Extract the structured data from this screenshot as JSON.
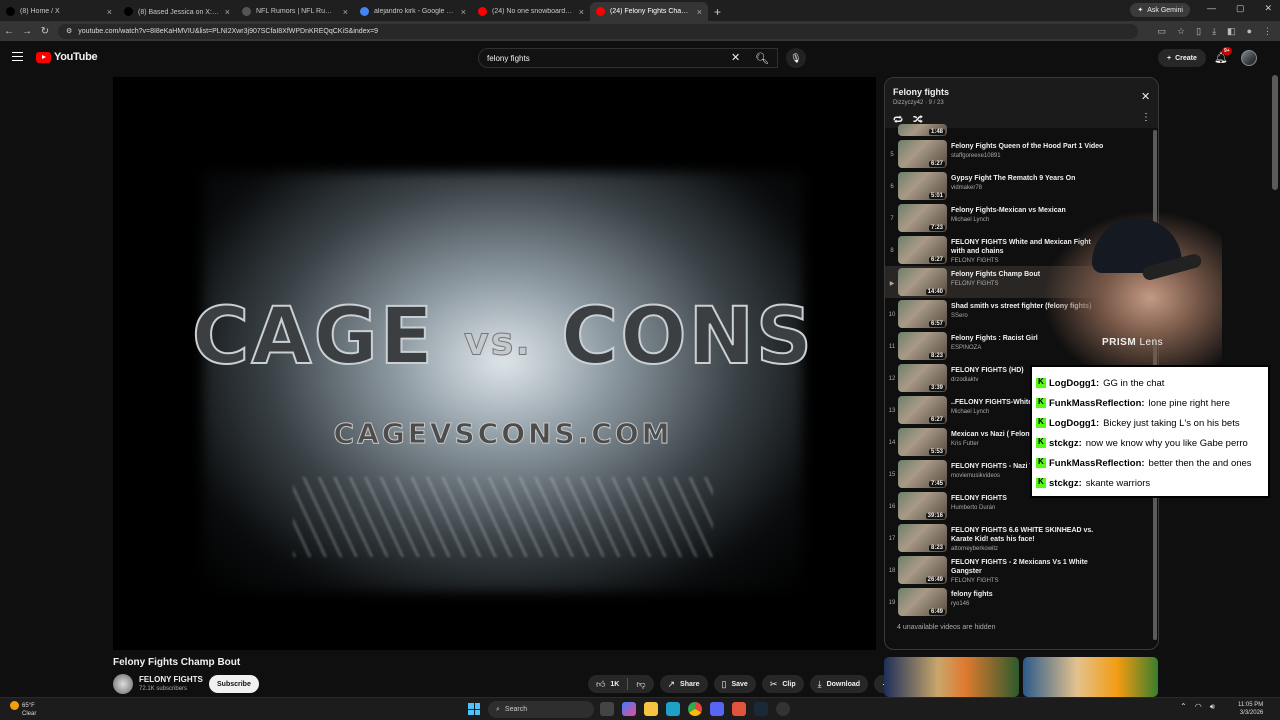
{
  "browser": {
    "tabs": [
      {
        "label": "(8) Home / X",
        "icon": "x-logo-icon",
        "color": "#000000"
      },
      {
        "label": "(8) Based Jessica on X: \"🚨 Arti",
        "icon": "x-logo-icon",
        "color": "#000000"
      },
      {
        "label": "NFL Rumors | NFL Rumors New",
        "icon": "page-icon",
        "color": "#555555"
      },
      {
        "label": "alejandro kirk - Google Search",
        "icon": "google-icon",
        "color": "#4285f4"
      },
      {
        "label": "(24) No one snowboards like Ze",
        "icon": "youtube-icon",
        "color": "#ff0000"
      },
      {
        "label": "(24) Felony Fights Champ Bout",
        "icon": "youtube-icon",
        "color": "#ff0000",
        "active": true
      }
    ],
    "new_tab": "+",
    "ask_gemini": "Ask Gemini",
    "url": "youtube.com/watch?v=8I8eKaHMVIU&list=PLNI2Xwr3j907SCfaI8XfWPDnKREQqCKiS&index=9"
  },
  "header": {
    "logo": "YouTube",
    "search_value": "felony fights",
    "create_label": "Create",
    "notification_count": "9+"
  },
  "video": {
    "title_art": "CAGE",
    "vs_art": "vs.",
    "cons_art": "CONS",
    "url_art": "CAGEVSCONS.COM",
    "title": "Felony Fights Champ Bout",
    "channel": "FELONY FIGHTS",
    "subscribers": "72.1K subscribers",
    "subscribe_label": "Subscribe",
    "likes": "1K",
    "share_label": "Share",
    "save_label": "Save",
    "clip_label": "Clip",
    "download_label": "Download"
  },
  "playlist": {
    "title": "Felony fights",
    "subtitle": "Dizzyczy42 · 9 / 23",
    "hidden_note": "4 unavailable videos are hidden",
    "items": [
      {
        "idx": "",
        "title": "",
        "channel": "",
        "duration": "1:48",
        "partial": true
      },
      {
        "idx": "5",
        "title": "Felony Fights Queen of the Hood Part 1 Video",
        "channel": "staffgoreexe10891",
        "duration": "6:27"
      },
      {
        "idx": "6",
        "title": "Gypsy Fight The Rematch 9 Years On",
        "channel": "vidmaker78",
        "duration": "5:01"
      },
      {
        "idx": "7",
        "title": "Felony Fights-Mexican vs Mexican",
        "channel": "Michael Lynch",
        "duration": "7:23"
      },
      {
        "idx": "8",
        "title": "FELONY FIGHTS White and Mexican Fight with and chains",
        "channel": "FELONY FIGHTS",
        "duration": "6:27"
      },
      {
        "idx": "▶",
        "title": "Felony Fights Champ Bout",
        "channel": "FELONY FIGHTS",
        "duration": "14:40",
        "current": true
      },
      {
        "idx": "10",
        "title": "Shad smith vs street fighter (felony fights)",
        "channel": "SSero",
        "duration": "6:57"
      },
      {
        "idx": "11",
        "title": "Felony Fights : Racist Girl",
        "channel": "ESPINOZA",
        "duration": "8:23"
      },
      {
        "idx": "12",
        "title": "FELONY FIGHTS (HD)",
        "channel": "drzodiaktv",
        "duration": "3:39"
      },
      {
        "idx": "13",
        "title": "..FELONY FIGHTS-White and chains",
        "channel": "Michael Lynch",
        "duration": "6:27"
      },
      {
        "idx": "14",
        "title": "Mexican vs Nazi ( Felony",
        "channel": "Kris Futter",
        "duration": "5:53"
      },
      {
        "idx": "15",
        "title": "FELONY FIGHTS - Nazi Vs",
        "channel": "moviemusikvideos",
        "duration": "7:45"
      },
      {
        "idx": "16",
        "title": "FELONY FIGHTS",
        "channel": "Humberto Durán",
        "duration": "39:16"
      },
      {
        "idx": "17",
        "title": "FELONY FIGHTS 6.6 WHITE SKINHEAD vs. Karate Kid! eats his face!",
        "channel": "attorneyberkowitz",
        "duration": "8:23"
      },
      {
        "idx": "18",
        "title": "FELONY FIGHTS - 2 Mexicans Vs 1 White Gangster",
        "channel": "FELONY FIGHTS",
        "duration": "26:49"
      },
      {
        "idx": "19",
        "title": "felony fights",
        "channel": "ryo146",
        "duration": "6:49"
      }
    ]
  },
  "overlay": {
    "brand_bold": "PRISM",
    "brand_light": "Lens",
    "chat": [
      {
        "user": "LogDogg1:",
        "msg": "GG in the chat"
      },
      {
        "user": "FunkMassReflection:",
        "msg": "lone pine right here"
      },
      {
        "user": "LogDogg1:",
        "msg": "Bickey just taking L's on his bets"
      },
      {
        "user": "stckgz:",
        "msg": "now we know why you like Gabe perro"
      },
      {
        "user": "FunkMassReflection:",
        "msg": "better then the and ones"
      },
      {
        "user": "stckgz:",
        "msg": "skante warriors"
      }
    ]
  },
  "taskbar": {
    "weather_temp": "65°F",
    "weather_desc": "Clear",
    "search_placeholder": "Search",
    "time": "11:05 PM",
    "date": "3/3/2026"
  }
}
